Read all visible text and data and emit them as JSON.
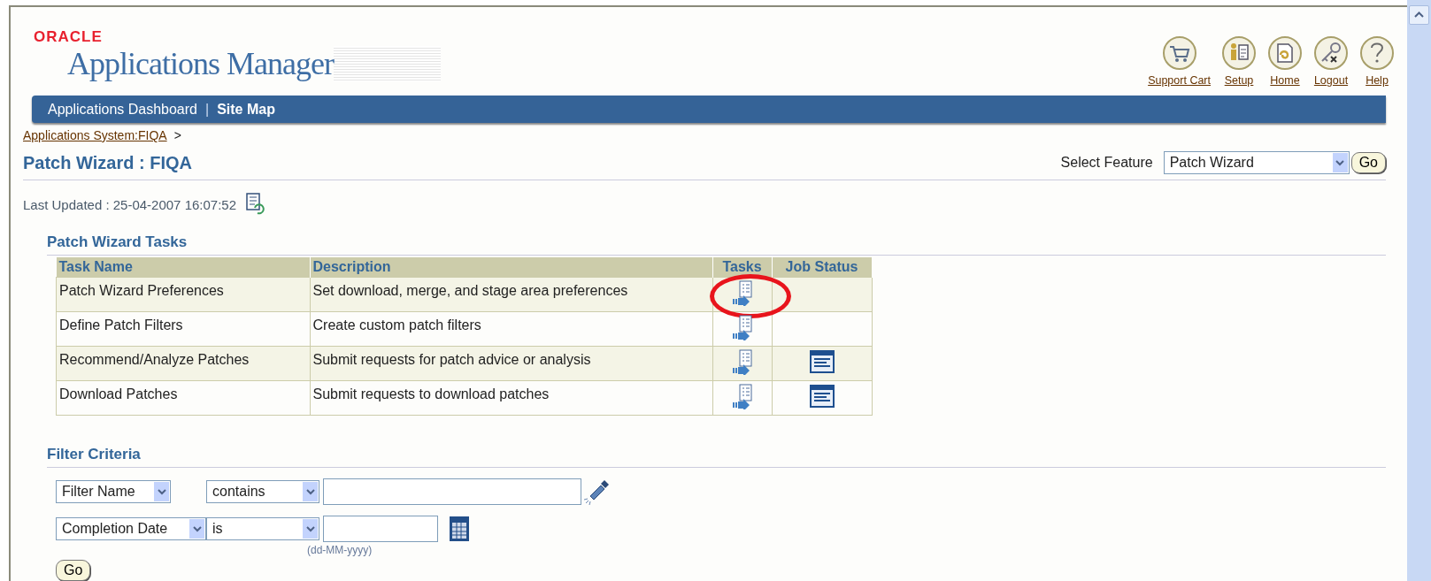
{
  "header": {
    "brand": "ORACLE",
    "product": "Applications Manager",
    "global_links": [
      {
        "label": "Support Cart"
      },
      {
        "label": "Setup"
      },
      {
        "label": "Home"
      },
      {
        "label": "Logout"
      },
      {
        "label": "Help"
      }
    ]
  },
  "nav": {
    "items": [
      {
        "label": "Applications Dashboard",
        "selected": false
      },
      {
        "label": "Site Map",
        "selected": true
      }
    ],
    "separator": "|"
  },
  "breadcrumb": {
    "link": "Applications System:FIQA",
    "separator": ">"
  },
  "page_title": "Patch Wizard : FIQA",
  "feature_select": {
    "label": "Select Feature",
    "value": "Patch Wizard",
    "button": "Go"
  },
  "last_updated": "Last Updated : 25-04-2007 16:07:52",
  "tasks": {
    "title": "Patch Wizard Tasks",
    "columns": [
      "Task Name",
      "Description",
      "Tasks",
      "Job Status"
    ],
    "rows": [
      {
        "name": "Patch Wizard Preferences",
        "description": "Set download, merge, and stage area preferences",
        "has_job_status": false,
        "circled": true
      },
      {
        "name": "Define Patch Filters",
        "description": "Create custom patch filters",
        "has_job_status": false,
        "circled": false
      },
      {
        "name": "Recommend/Analyze Patches",
        "description": "Submit requests for patch advice or analysis",
        "has_job_status": true,
        "circled": false
      },
      {
        "name": "Download Patches",
        "description": "Submit requests to download patches",
        "has_job_status": true,
        "circled": false
      }
    ]
  },
  "filter": {
    "title": "Filter Criteria",
    "rows": [
      {
        "kind": "text",
        "field": "Filter Name",
        "operator": "contains"
      },
      {
        "kind": "date",
        "field": "Completion Date",
        "operator": "is",
        "hint": "(dd-MM-yyyy)"
      }
    ],
    "button": "Go"
  }
}
